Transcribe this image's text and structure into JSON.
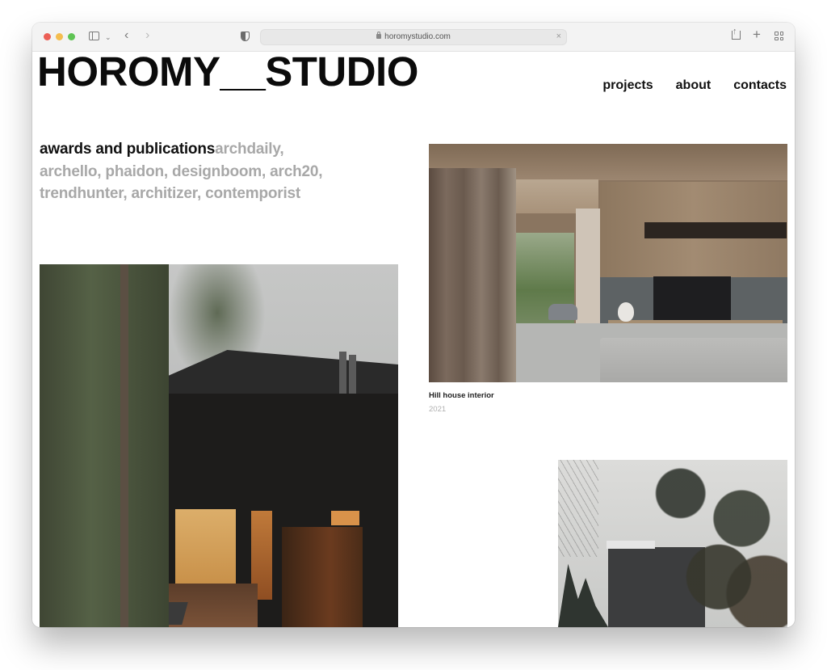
{
  "browser": {
    "url": "horomystudio.com",
    "icons": {
      "traffic_lights": [
        "close",
        "minimize",
        "zoom"
      ],
      "sidebar": "sidebar-icon",
      "sidebar_menu": "chevron-down-icon",
      "back": "‹",
      "forward": "›",
      "privacy": "shield-icon",
      "clear": "×",
      "share": "share-icon",
      "new_tab": "+",
      "tab_overview": "tabs-grid-icon"
    }
  },
  "site": {
    "logo": "HOROMY__STUDIO",
    "nav": [
      {
        "label": "projects"
      },
      {
        "label": "about"
      },
      {
        "label": "contacts"
      }
    ],
    "awards": {
      "lead": "awards and publications",
      "publications": "archdaily, archello, phaidon, designboom, arch20, trendhunter, architizer, contemporist"
    },
    "projects": [
      {
        "title": "Hill house interior",
        "year": "2021",
        "image": "interior living room with wood paneled wall, TV and grey sofa"
      },
      {
        "title": "",
        "year": "",
        "image": "black wooden house in pine forest with lit windows"
      },
      {
        "title": "",
        "year": "",
        "image": "dark house behind snow-covered pine branches"
      }
    ]
  },
  "colors": {
    "text_primary": "#111111",
    "text_muted": "#a8a8a8",
    "caption_year": "#b0b0b0",
    "toolbar_bg": "#f3f3f3"
  }
}
